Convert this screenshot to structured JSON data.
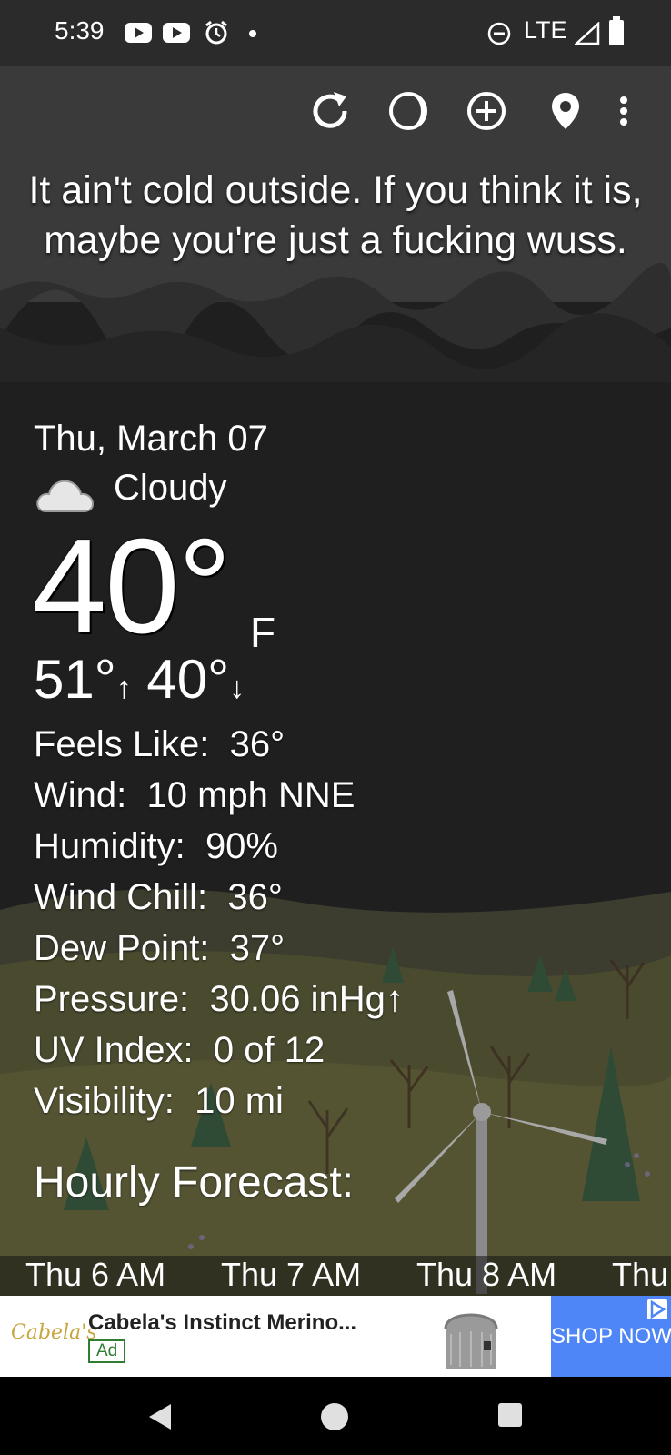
{
  "status_bar": {
    "time": "5:39",
    "network": "LTE",
    "icons": [
      "youtube-icon",
      "youtube-icon",
      "alarm-icon",
      "notification-dot",
      "do-not-disturb-icon",
      "signal-icon",
      "battery-icon"
    ]
  },
  "toolbar": {
    "icons": [
      "refresh-icon",
      "moon-phase-icon",
      "add-location-icon",
      "location-pin-icon",
      "more-vert-icon"
    ]
  },
  "quote": "It ain't cold outside. If you think it is, maybe you're just a fucking wuss.",
  "current": {
    "date": "Thu, March 07",
    "condition": "Cloudy",
    "condition_icon": "cloud-icon",
    "temperature": "40°",
    "unit": "F",
    "high": "51°",
    "low": "40°",
    "high_arrow": "↑",
    "low_arrow": "↓"
  },
  "details": [
    {
      "label": "Feels Like:",
      "value": "36°"
    },
    {
      "label": "Wind:",
      "value": "10 mph NNE"
    },
    {
      "label": "Humidity:",
      "value": "90%"
    },
    {
      "label": "Wind Chill:",
      "value": "36°"
    },
    {
      "label": "Dew Point:",
      "value": "37°"
    },
    {
      "label": "Pressure:",
      "value": "30.06 inHg↑"
    },
    {
      "label": "UV Index:",
      "value": "0 of 12"
    },
    {
      "label": "Visibility:",
      "value": "10 mi"
    }
  ],
  "hourly": {
    "title": "Hourly Forecast:",
    "labels": [
      "Thu 6 AM",
      "Thu 7 AM",
      "Thu 8 AM",
      "Thu"
    ]
  },
  "ad": {
    "brand": "Cabela's",
    "title": "Cabela's Instinct Merino...",
    "badge": "Ad",
    "cta": "SHOP NOW"
  },
  "colors": {
    "background": "#1f1f1f",
    "status_bar": "#2b2b2b",
    "ad_cta": "#4f86f7",
    "ad_badge": "#2e7d32"
  }
}
